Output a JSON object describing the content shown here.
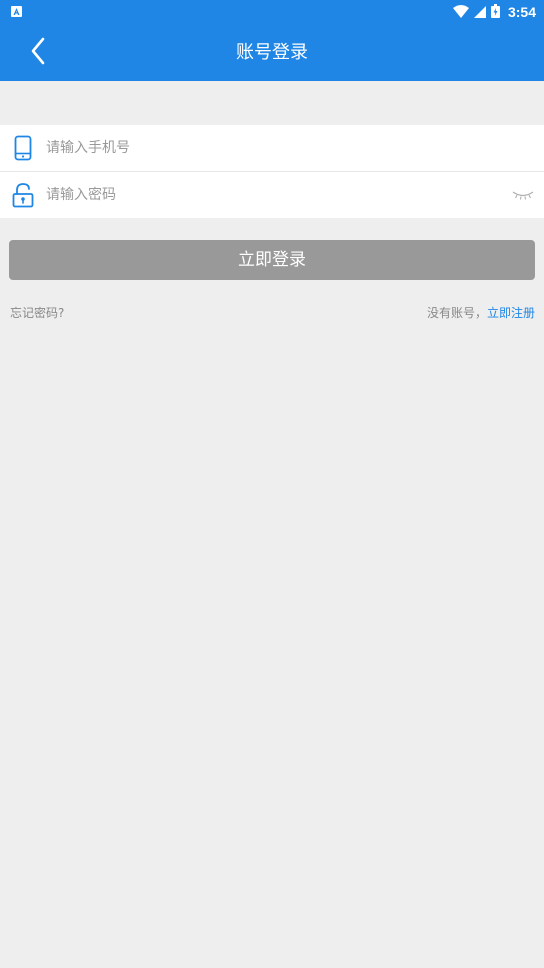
{
  "status_bar": {
    "time": "3:54"
  },
  "header": {
    "title": "账号登录"
  },
  "form": {
    "phone_placeholder": "请输入手机号",
    "password_placeholder": "请输入密码"
  },
  "actions": {
    "login_label": "立即登录",
    "forgot_label": "忘记密码?",
    "no_account_text": "没有账号，",
    "register_label": "立即注册"
  },
  "colors": {
    "primary": "#1f86e6",
    "background": "#eeeeee",
    "button_disabled": "#999999"
  },
  "icons": {
    "back": "chevron-left-icon",
    "phone": "phone-icon",
    "lock": "lock-icon",
    "eye": "eye-closed-icon"
  }
}
